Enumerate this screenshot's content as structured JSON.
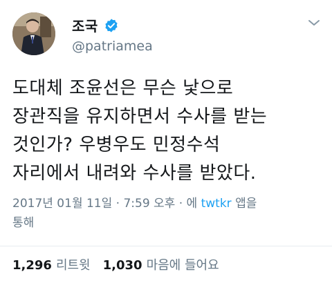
{
  "user": {
    "name": "조국",
    "handle": "@patriamea"
  },
  "tweet": {
    "lines": [
      "도대체 조윤선은 무슨 낯으로",
      "장관직을 유지하면서 수사를 받는",
      "것인가? 우병우도 민정수석",
      "자리에서 내려와 수사를 받았다."
    ]
  },
  "meta": {
    "line1_prefix": "2017년 01월 11일 · 7:59 오후 · 에 ",
    "source": "twtkr",
    "line1_suffix": " 앱을",
    "line2": "통해"
  },
  "stats": {
    "retweets": "1,296",
    "retweets_label": "리트윗",
    "likes": "1,030",
    "likes_label": "마음에 들어요"
  },
  "colors": {
    "verified": "#1da1f2",
    "muted": "#657786",
    "link": "#1da1f2"
  },
  "icons": {
    "verified": "verified-badge-icon",
    "menu": "chevron-down-icon"
  }
}
